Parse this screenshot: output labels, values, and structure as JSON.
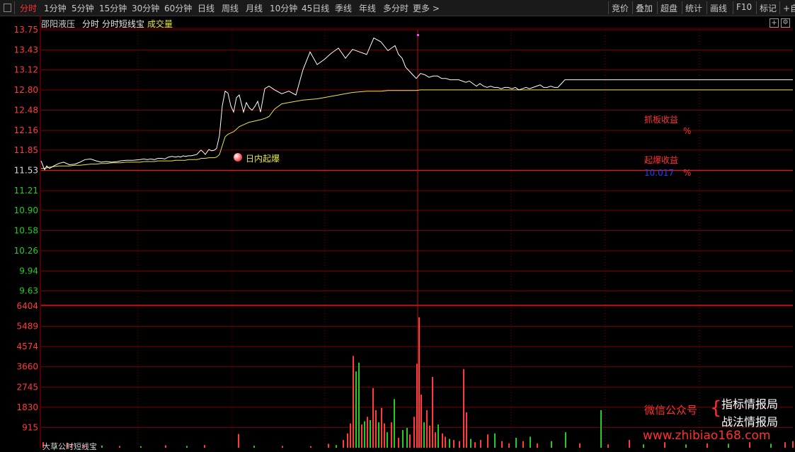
{
  "toolbar": {
    "left_items": [
      "分时",
      "1分钟",
      "5分钟",
      "15分钟",
      "30分钟",
      "60分钟",
      "日线",
      "周线",
      "月线",
      "10分钟",
      "45日线",
      "季线",
      "年线",
      "多分时",
      "更多 >"
    ],
    "active_index": 0,
    "right_items": [
      "竞价",
      "叠加",
      "超盘",
      "统计",
      "画线",
      "F10",
      "标记",
      "+自"
    ]
  },
  "header": {
    "stock_name": "邵阳液压",
    "mode": "分时",
    "indicator": "分时短线宝",
    "volume_label": "成交量"
  },
  "annotations": {
    "intraday_event": "日内起爆",
    "grab_profit_label": "抓板收益",
    "grab_profit_unit": "%",
    "burst_profit_label": "起爆收益",
    "burst_profit_value": "10.017",
    "burst_profit_unit": "%"
  },
  "watermark": {
    "wechat": "微信公众号",
    "line1": "指标情报局",
    "line2": "战法情报局",
    "url": "www.zhibiao168.com"
  },
  "footer_partial": "大草公时短线宝",
  "colors": {
    "up": "#ff3b3b",
    "down": "#22cc22",
    "price_line": "#ffffff",
    "avg_line": "#e8e84a",
    "grid": "#7a0000",
    "blue_value": "#2040ff",
    "magenta_mark": "#ff40ff"
  },
  "chart_data": [
    {
      "type": "line",
      "title": "",
      "ylim": [
        9.31,
        13.75
      ],
      "y_ticks": [
        "13.75",
        "13.43",
        "13.12",
        "12.80",
        "12.48",
        "12.16",
        "11.85",
        "11.53",
        "11.21",
        "10.90",
        "10.58",
        "10.26",
        "9.94",
        "9.63"
      ],
      "prev_close": 11.53,
      "x": [
        0,
        5,
        8,
        12,
        18,
        25,
        32,
        40,
        48,
        55,
        62,
        70,
        78,
        85,
        92,
        100,
        108,
        112,
        120,
        130,
        140,
        145,
        150,
        155,
        160,
        165,
        170,
        175,
        180,
        185,
        190,
        194,
        197,
        201,
        204,
        208,
        212,
        216,
        220,
        224,
        226,
        229,
        232,
        237,
        241,
        245,
        248,
        252,
        256,
        260,
        264,
        268,
        272,
        276,
        280,
        286,
        290,
        294,
        298,
        302,
        306,
        310,
        316,
        322,
        330,
        340,
        350,
        360,
        370,
        380,
        390,
        400,
        410,
        420,
        430,
        440,
        450,
        460,
        470,
        480,
        490,
        500,
        505,
        510,
        515,
        520,
        525,
        530,
        536,
        542,
        548,
        554,
        560,
        566,
        572,
        578,
        584,
        590,
        595,
        600,
        605,
        610,
        615,
        620,
        625,
        630,
        635,
        640,
        645,
        650,
        655,
        660,
        665,
        670,
        675,
        680,
        685,
        690,
        695,
        700,
        705,
        710,
        715,
        720,
        725,
        730,
        735,
        740
      ],
      "series": [
        {
          "values": [
            11.68,
            11.54,
            11.6,
            11.56,
            11.6,
            11.64,
            11.66,
            11.62,
            11.63,
            11.66,
            11.7,
            11.71,
            11.68,
            11.66,
            11.67,
            11.66,
            11.67,
            11.68,
            11.69,
            11.69,
            11.7,
            11.71,
            11.7,
            11.71,
            11.7,
            11.72,
            11.72,
            11.71,
            11.74,
            11.75,
            11.74,
            11.75,
            11.74,
            11.76,
            11.75,
            11.76,
            11.76,
            11.77,
            11.78,
            11.83,
            11.85,
            11.82,
            11.78,
            11.86,
            11.84,
            11.85,
            11.88,
            12.08,
            12.55,
            12.78,
            12.75,
            12.55,
            12.45,
            12.68,
            12.72,
            12.45,
            12.6,
            12.52,
            12.48,
            12.54,
            12.62,
            12.45,
            12.82,
            12.86,
            12.8,
            12.74,
            12.78,
            12.72,
            13.12,
            13.4,
            13.2,
            13.28,
            13.38,
            13.46,
            13.3,
            13.44,
            13.4,
            13.36,
            13.62,
            13.56,
            13.42,
            13.5,
            13.36,
            13.3,
            13.16,
            13.1,
            13.04,
            12.98,
            13.06,
            13.04,
            13.0,
            13.02,
            13.02,
            12.98,
            12.98,
            12.96,
            12.96,
            12.96,
            12.94,
            12.92,
            12.94,
            12.9,
            12.86,
            12.9,
            12.86,
            12.84,
            12.86,
            12.84,
            12.84,
            12.82,
            12.84,
            12.84,
            12.82,
            12.84,
            12.8,
            12.82,
            12.84,
            12.82,
            12.84,
            12.86,
            12.88,
            12.84,
            12.84,
            12.86,
            12.84,
            12.84,
            12.9,
            12.96
          ]
        },
        {
          "values": [
            11.56,
            11.56,
            11.57,
            11.58,
            11.59,
            11.6,
            11.6,
            11.6,
            11.61,
            11.61,
            11.62,
            11.63,
            11.63,
            11.64,
            11.64,
            11.65,
            11.65,
            11.65,
            11.66,
            11.66,
            11.66,
            11.67,
            11.67,
            11.67,
            11.67,
            11.68,
            11.68,
            11.68,
            11.68,
            11.68,
            11.69,
            11.69,
            11.69,
            11.69,
            11.69,
            11.7,
            11.7,
            11.7,
            11.7,
            11.71,
            11.72,
            11.72,
            11.72,
            11.73,
            11.73,
            11.73,
            11.74,
            11.78,
            11.92,
            12.06,
            12.1,
            12.12,
            12.14,
            12.18,
            12.22,
            12.25,
            12.27,
            12.29,
            12.3,
            12.31,
            12.32,
            12.33,
            12.35,
            12.38,
            12.5,
            12.58,
            12.6,
            12.62,
            12.64,
            12.65,
            12.66,
            12.68,
            12.7,
            12.72,
            12.74,
            12.76,
            12.77,
            12.78,
            12.78,
            12.78,
            12.79,
            12.79,
            12.79,
            12.79,
            12.79,
            12.79,
            12.79,
            12.79,
            12.8,
            12.8,
            12.8,
            12.8,
            12.8,
            12.8,
            12.8,
            12.8,
            12.8,
            12.8,
            12.8,
            12.8,
            12.8,
            12.8,
            12.8,
            12.8,
            12.8,
            12.8,
            12.8,
            12.8,
            12.8,
            12.8,
            12.8,
            12.8,
            12.8,
            12.8,
            12.8,
            12.8,
            12.8,
            12.8,
            12.8,
            12.8,
            12.8,
            12.8,
            12.8,
            12.8,
            12.8,
            12.8,
            12.8,
            12.8
          ]
        }
      ]
    },
    {
      "type": "bar",
      "title": "成交量",
      "ylim": [
        0,
        6404
      ],
      "y_ticks": [
        "6404",
        "5489",
        "4574",
        "3660",
        "2745",
        "1830",
        "915"
      ],
      "bars": [
        {
          "x": 2,
          "v": 250,
          "up": true
        },
        {
          "x": 20,
          "v": 90,
          "up": false
        },
        {
          "x": 36,
          "v": 230,
          "up": true
        },
        {
          "x": 42,
          "v": 180,
          "up": true
        },
        {
          "x": 60,
          "v": 120,
          "up": true
        },
        {
          "x": 85,
          "v": 100,
          "up": false
        },
        {
          "x": 110,
          "v": 80,
          "up": true
        },
        {
          "x": 140,
          "v": 70,
          "up": false
        },
        {
          "x": 175,
          "v": 110,
          "up": true
        },
        {
          "x": 205,
          "v": 80,
          "up": false
        },
        {
          "x": 230,
          "v": 120,
          "up": true
        },
        {
          "x": 278,
          "v": 620,
          "up": true
        },
        {
          "x": 300,
          "v": 90,
          "up": false
        },
        {
          "x": 340,
          "v": 80,
          "up": true
        },
        {
          "x": 380,
          "v": 70,
          "up": true
        },
        {
          "x": 405,
          "v": 180,
          "up": true
        },
        {
          "x": 416,
          "v": 120,
          "up": false
        },
        {
          "x": 426,
          "v": 350,
          "up": true
        },
        {
          "x": 432,
          "v": 650,
          "up": true
        },
        {
          "x": 436,
          "v": 1100,
          "up": true
        },
        {
          "x": 440,
          "v": 4150,
          "up": true
        },
        {
          "x": 444,
          "v": 3450,
          "up": false
        },
        {
          "x": 448,
          "v": 3850,
          "up": false
        },
        {
          "x": 452,
          "v": 1050,
          "up": true
        },
        {
          "x": 456,
          "v": 1200,
          "up": false
        },
        {
          "x": 460,
          "v": 1400,
          "up": true
        },
        {
          "x": 464,
          "v": 1250,
          "up": false
        },
        {
          "x": 468,
          "v": 2700,
          "up": true
        },
        {
          "x": 472,
          "v": 1700,
          "up": true
        },
        {
          "x": 476,
          "v": 1150,
          "up": false
        },
        {
          "x": 480,
          "v": 1800,
          "up": true
        },
        {
          "x": 484,
          "v": 1100,
          "up": true
        },
        {
          "x": 488,
          "v": 700,
          "up": false
        },
        {
          "x": 494,
          "v": 1150,
          "up": true
        },
        {
          "x": 498,
          "v": 2200,
          "up": false
        },
        {
          "x": 504,
          "v": 450,
          "up": true
        },
        {
          "x": 510,
          "v": 800,
          "up": false
        },
        {
          "x": 516,
          "v": 900,
          "up": false
        },
        {
          "x": 520,
          "v": 600,
          "up": true
        },
        {
          "x": 526,
          "v": 1400,
          "up": true
        },
        {
          "x": 530,
          "v": 3800,
          "up": true
        },
        {
          "x": 533,
          "v": 5900,
          "up": true
        },
        {
          "x": 536,
          "v": 2400,
          "up": true
        },
        {
          "x": 540,
          "v": 1150,
          "up": false
        },
        {
          "x": 544,
          "v": 1700,
          "up": true
        },
        {
          "x": 548,
          "v": 1000,
          "up": true
        },
        {
          "x": 552,
          "v": 3200,
          "up": true
        },
        {
          "x": 556,
          "v": 700,
          "up": true
        },
        {
          "x": 560,
          "v": 1050,
          "up": false
        },
        {
          "x": 566,
          "v": 650,
          "up": true
        },
        {
          "x": 570,
          "v": 500,
          "up": true
        },
        {
          "x": 576,
          "v": 400,
          "up": false
        },
        {
          "x": 582,
          "v": 350,
          "up": true
        },
        {
          "x": 590,
          "v": 300,
          "up": true
        },
        {
          "x": 596,
          "v": 3550,
          "up": true
        },
        {
          "x": 600,
          "v": 1600,
          "up": true
        },
        {
          "x": 606,
          "v": 400,
          "up": false
        },
        {
          "x": 612,
          "v": 250,
          "up": true
        },
        {
          "x": 620,
          "v": 350,
          "up": true
        },
        {
          "x": 630,
          "v": 600,
          "up": true
        },
        {
          "x": 640,
          "v": 650,
          "up": false
        },
        {
          "x": 650,
          "v": 300,
          "up": true
        },
        {
          "x": 660,
          "v": 200,
          "up": true
        },
        {
          "x": 670,
          "v": 450,
          "up": false
        },
        {
          "x": 680,
          "v": 300,
          "up": true
        },
        {
          "x": 690,
          "v": 500,
          "up": false
        },
        {
          "x": 700,
          "v": 200,
          "up": true
        },
        {
          "x": 720,
          "v": 300,
          "up": false
        },
        {
          "x": 740,
          "v": 700,
          "up": false
        },
        {
          "x": 760,
          "v": 200,
          "up": true
        },
        {
          "x": 790,
          "v": 1700,
          "up": false
        },
        {
          "x": 800,
          "v": 150,
          "up": true
        },
        {
          "x": 830,
          "v": 350,
          "up": true
        },
        {
          "x": 850,
          "v": 150,
          "up": false
        },
        {
          "x": 880,
          "v": 250,
          "up": true
        },
        {
          "x": 910,
          "v": 150,
          "up": false
        },
        {
          "x": 940,
          "v": 200,
          "up": true
        },
        {
          "x": 970,
          "v": 180,
          "up": false
        },
        {
          "x": 1000,
          "v": 250,
          "up": true
        },
        {
          "x": 1030,
          "v": 180,
          "up": false
        },
        {
          "x": 1050,
          "v": 250,
          "up": true
        },
        {
          "x": 1061,
          "v": 300,
          "up": true
        },
        {
          "x": 1068,
          "v": 350,
          "up": false
        },
        {
          "x": 1080,
          "v": 500,
          "up": true
        },
        {
          "x": 1086,
          "v": 250,
          "up": false
        },
        {
          "x": 1100,
          "v": 350,
          "up": true
        }
      ]
    }
  ]
}
